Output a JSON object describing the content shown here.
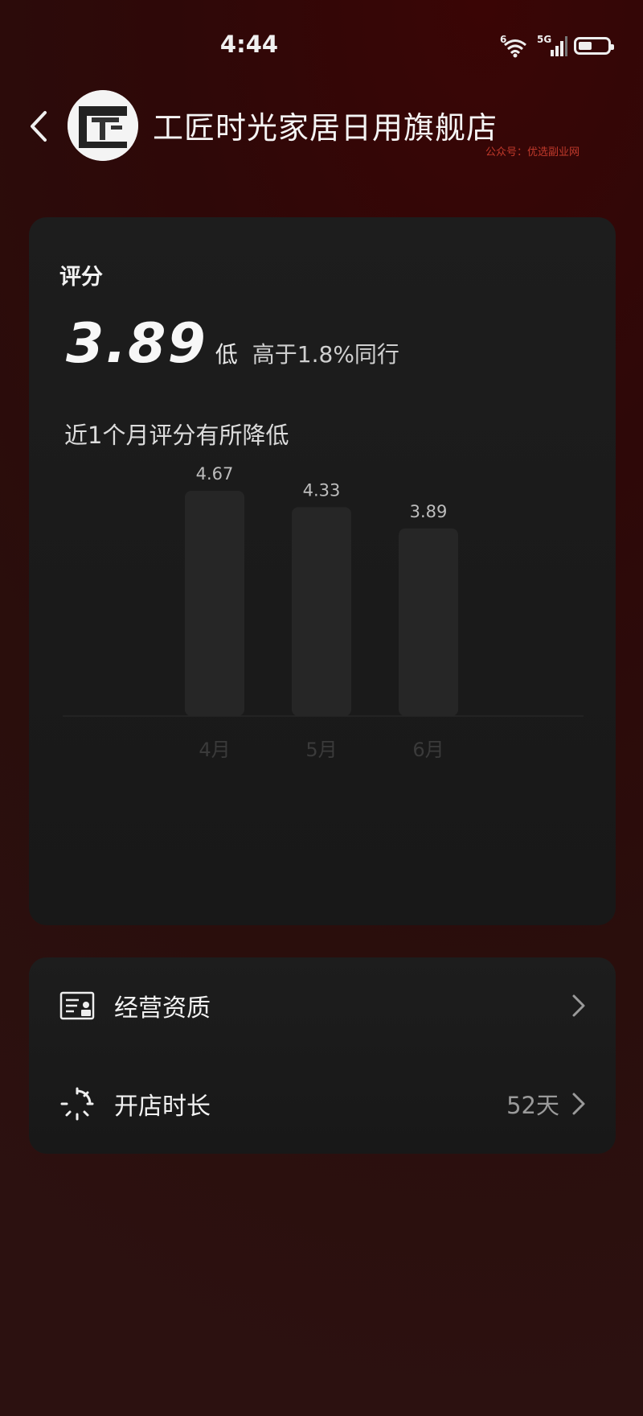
{
  "status_bar": {
    "time": "4:44",
    "network": "5G",
    "wifi_badge": "6"
  },
  "header": {
    "store_name": "工匠时光家居日用旗舰店",
    "watermark": "公众号：优选副业网"
  },
  "score": {
    "label": "评分",
    "value": "3.89",
    "level": "低",
    "compare": "高于1.8%同行",
    "trend_text": "近1个月评分有所降低"
  },
  "chart_data": {
    "type": "bar",
    "categories": [
      "4月",
      "5月",
      "6月"
    ],
    "values": [
      4.67,
      4.33,
      3.89
    ],
    "value_labels": [
      "4.67",
      "4.33",
      "3.89"
    ],
    "ylim": [
      0,
      4.67
    ]
  },
  "info": {
    "qualification_label": "经营资质",
    "duration_label": "开店时长",
    "duration_value": "52天"
  },
  "colors": {
    "bar": "#262626",
    "accent_bg": "#3a0505"
  }
}
